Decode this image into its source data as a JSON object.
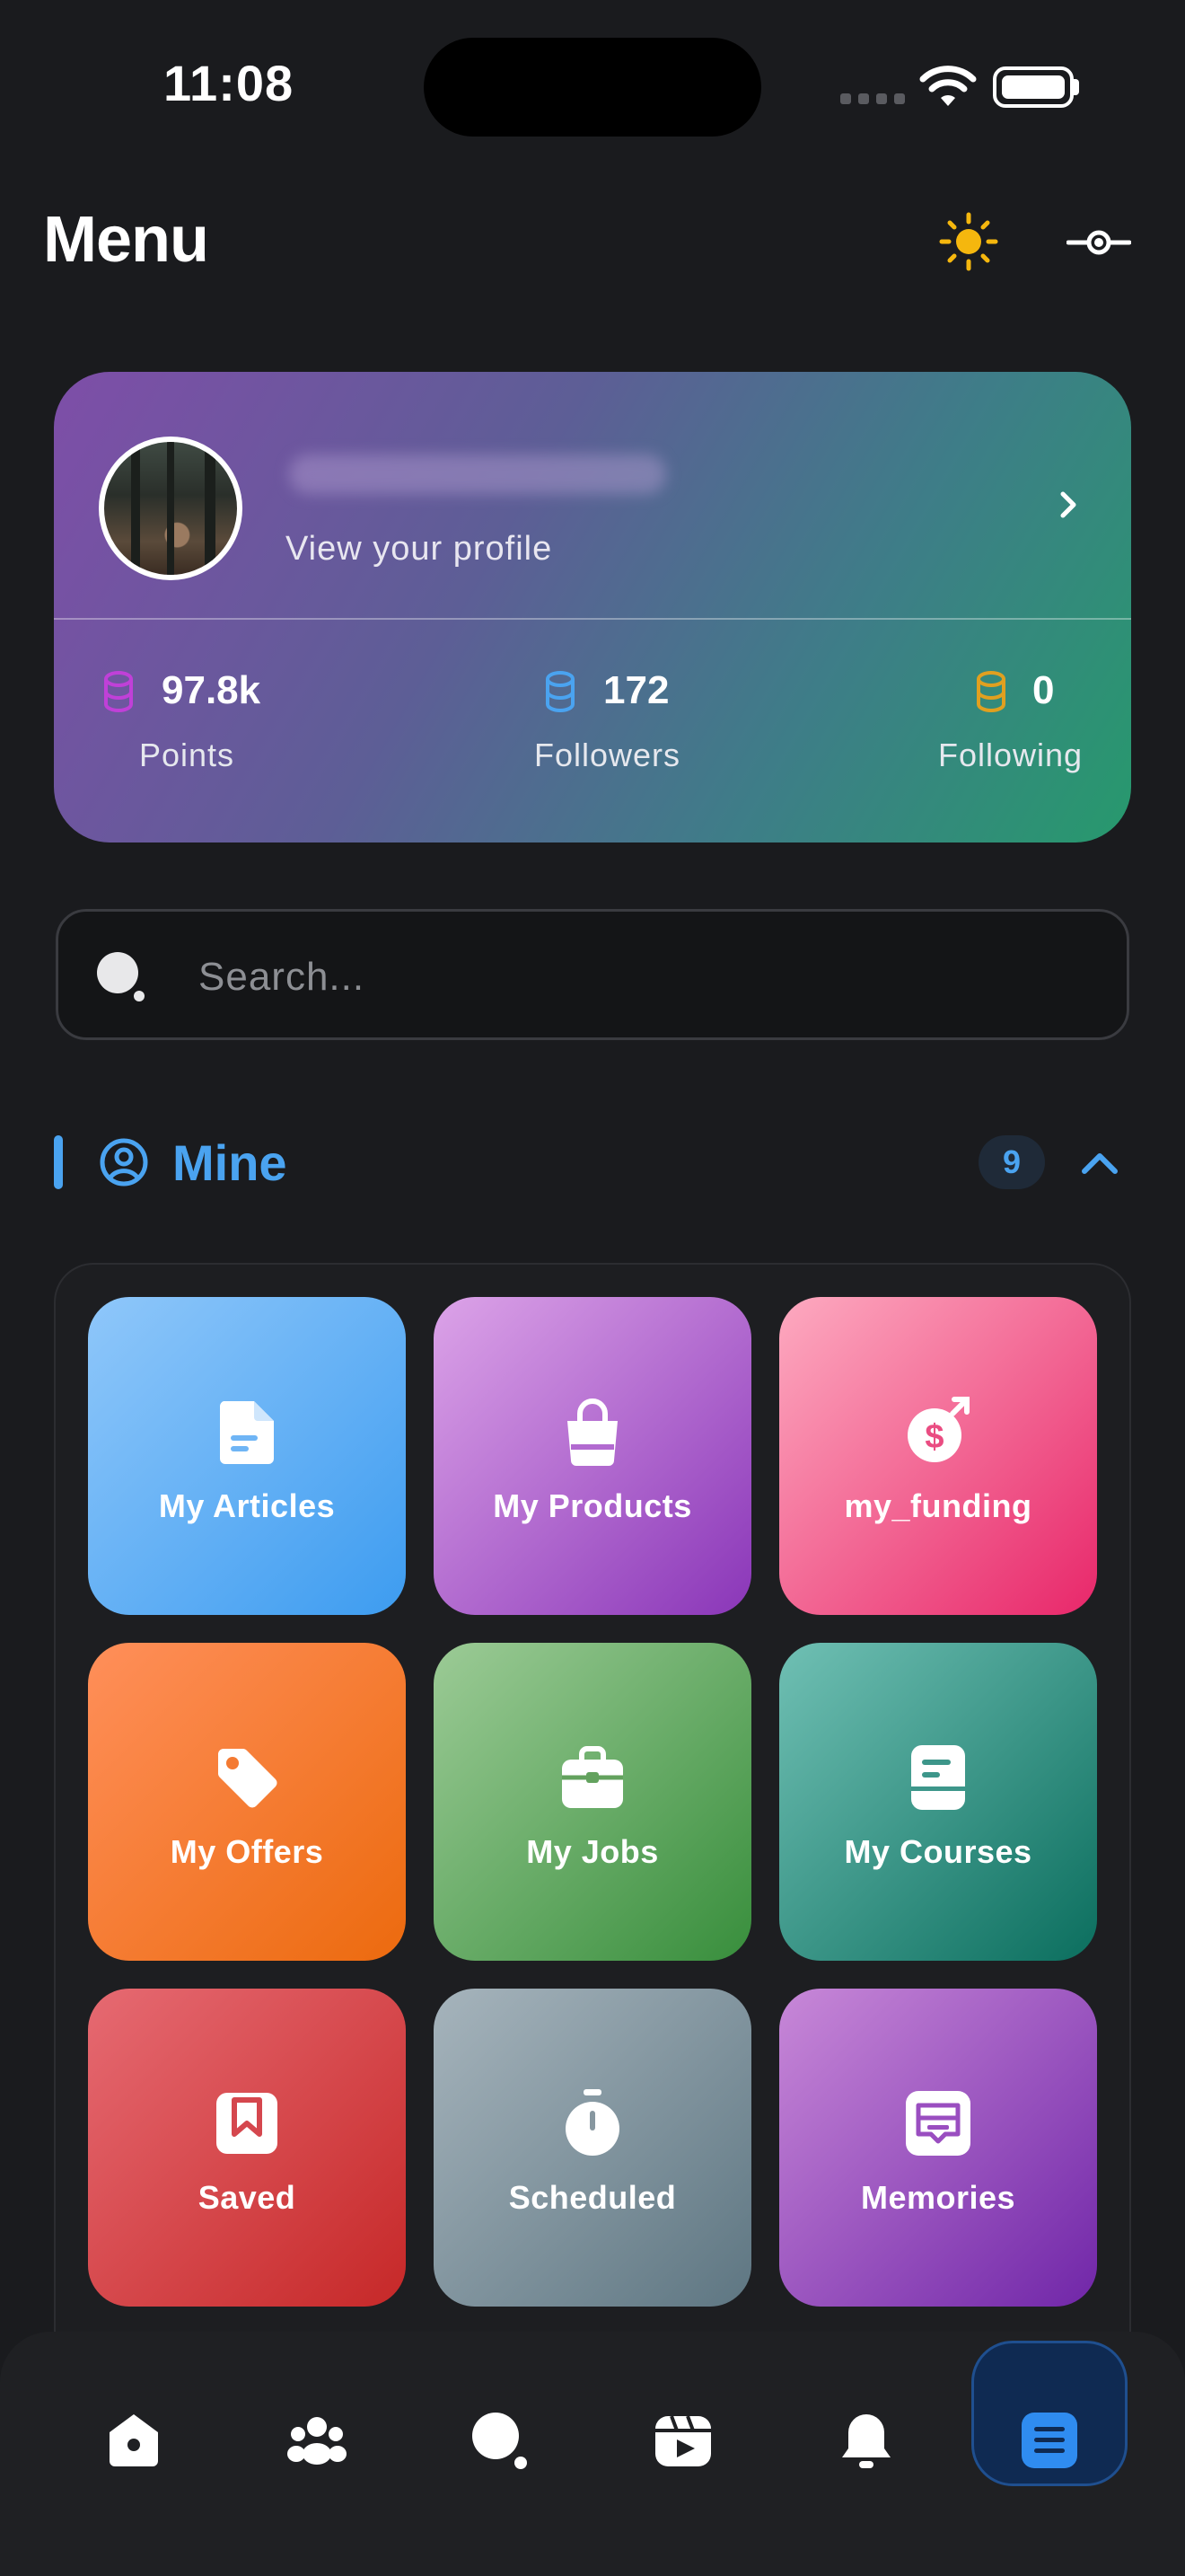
{
  "status_bar": {
    "time": "11:08"
  },
  "header": {
    "title": "Menu"
  },
  "profile": {
    "view_label": "View your profile",
    "stats": [
      {
        "value": "97.8k",
        "label": "Points",
        "color": "#c040d8"
      },
      {
        "value": "172",
        "label": "Followers",
        "color": "#4aa3f0"
      },
      {
        "value": "0",
        "label": "Following",
        "color": "#e0a020"
      }
    ]
  },
  "search": {
    "placeholder": "Search..."
  },
  "section": {
    "title": "Mine",
    "count": "9"
  },
  "tiles": [
    {
      "label": "My Articles",
      "icon": "document-icon",
      "colors": [
        "#8fc7fa",
        "#3d9cf0"
      ]
    },
    {
      "label": "My Products",
      "icon": "shopping-bag-icon",
      "colors": [
        "#dca3e8",
        "#8a36b8"
      ]
    },
    {
      "label": "my_funding",
      "icon": "funding-icon",
      "colors": [
        "#fdaac0",
        "#e8276a"
      ]
    },
    {
      "label": "My Offers",
      "icon": "tag-icon",
      "colors": [
        "#ff8f5a",
        "#ec6a0e"
      ]
    },
    {
      "label": "My Jobs",
      "icon": "briefcase-icon",
      "colors": [
        "#9ccb96",
        "#388e3c"
      ]
    },
    {
      "label": "My Courses",
      "icon": "course-icon",
      "colors": [
        "#70c0b4",
        "#0b6e5e"
      ]
    },
    {
      "label": "Saved",
      "icon": "bookmark-icon",
      "colors": [
        "#e66a72",
        "#c62828"
      ]
    },
    {
      "label": "Scheduled",
      "icon": "timer-icon",
      "colors": [
        "#a6b4bc",
        "#5e7682"
      ]
    },
    {
      "label": "Memories",
      "icon": "memories-icon",
      "colors": [
        "#c888d8",
        "#7026a8"
      ]
    }
  ],
  "nav": [
    "home-icon",
    "groups-icon",
    "search-icon",
    "reels-icon",
    "bell-icon",
    "menu-icon"
  ],
  "accent": "#4aa3f0"
}
